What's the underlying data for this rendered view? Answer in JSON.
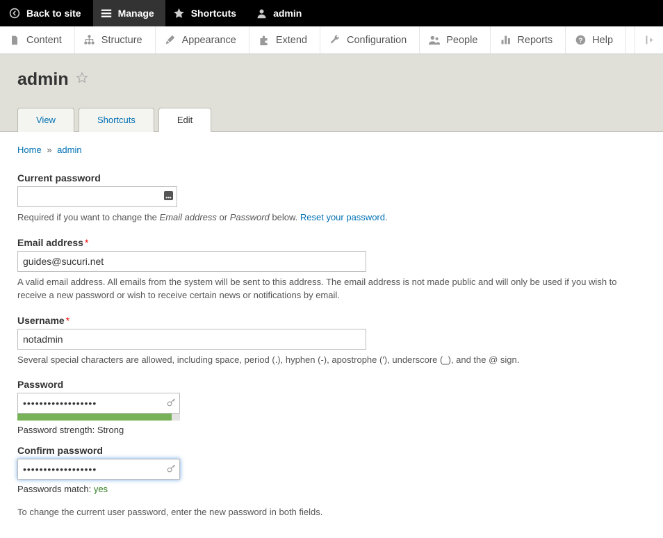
{
  "topbar": {
    "back": "Back to site",
    "manage": "Manage",
    "shortcuts": "Shortcuts",
    "user": "admin"
  },
  "toolbar": {
    "content": "Content",
    "structure": "Structure",
    "appearance": "Appearance",
    "extend": "Extend",
    "configuration": "Configuration",
    "people": "People",
    "reports": "Reports",
    "help": "Help"
  },
  "title": "admin",
  "tabs": {
    "view": "View",
    "shortcuts": "Shortcuts",
    "edit": "Edit",
    "active": "edit"
  },
  "breadcrumb": {
    "home": "Home",
    "current": "admin"
  },
  "form": {
    "current_password": {
      "label": "Current password",
      "value": "",
      "desc_prefix": "Required if you want to change the ",
      "desc_em1": "Email address",
      "desc_mid": " or ",
      "desc_em2": "Password",
      "desc_suffix": " below. ",
      "reset_link": "Reset your password",
      "desc_end": "."
    },
    "email": {
      "label": "Email address",
      "value": "guides@sucuri.net",
      "desc": "A valid email address. All emails from the system will be sent to this address. The email address is not made public and will only be used if you wish to receive a new password or wish to receive certain news or notifications by email."
    },
    "username": {
      "label": "Username",
      "value": "notadmin",
      "desc": "Several special characters are allowed, including space, period (.), hyphen (-), apostrophe ('), underscore (_), and the @ sign."
    },
    "password": {
      "label": "Password",
      "value": "••••••••••••••••••",
      "strength_label": "Password strength: ",
      "strength_value": "Strong"
    },
    "confirm": {
      "label": "Confirm password",
      "value": "••••••••••••••••••",
      "match_label": "Passwords match: ",
      "match_value": "yes"
    },
    "password_note": "To change the current user password, enter the new password in both fields."
  }
}
